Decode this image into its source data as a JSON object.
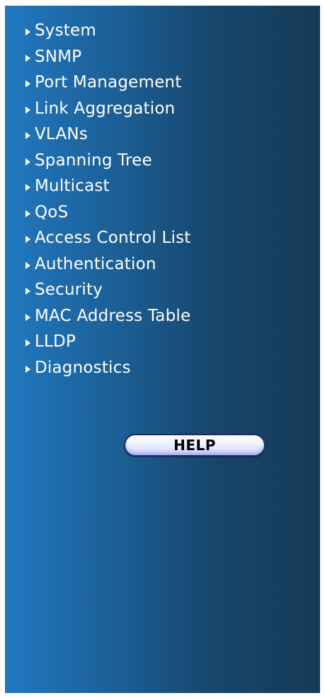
{
  "menu": {
    "items": [
      {
        "label": "System"
      },
      {
        "label": "SNMP"
      },
      {
        "label": "Port Management"
      },
      {
        "label": "Link Aggregation"
      },
      {
        "label": "VLANs"
      },
      {
        "label": "Spanning Tree"
      },
      {
        "label": "Multicast"
      },
      {
        "label": "QoS"
      },
      {
        "label": "Access Control List"
      },
      {
        "label": "Authentication"
      },
      {
        "label": "Security"
      },
      {
        "label": "MAC Address Table"
      },
      {
        "label": "LLDP"
      },
      {
        "label": "Diagnostics"
      }
    ],
    "icon": "triangle-right-icon"
  },
  "help": {
    "label": "HELP"
  },
  "colors": {
    "panel_gradient_start": "#2178c0",
    "panel_gradient_end": "#163a55",
    "text": "#ffffff",
    "button_border": "#1a2e66"
  }
}
